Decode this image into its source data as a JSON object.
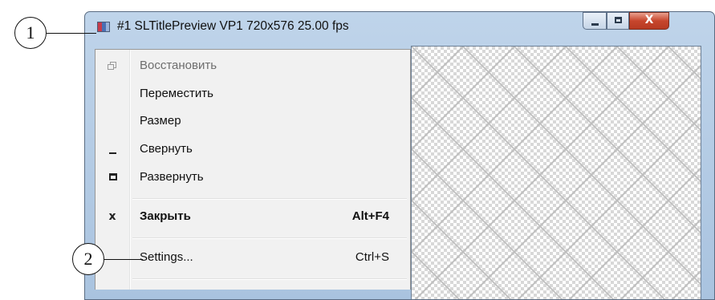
{
  "window": {
    "title": "#1 SLTitlePreview VP1 720x576 25.00 fps",
    "buttons": {
      "minimize": "minimize-icon",
      "maximize": "maximize-icon",
      "close_label": "X"
    }
  },
  "system_menu": {
    "items": [
      {
        "label": "Восстановить",
        "shortcut": "",
        "icon": "restore-icon",
        "disabled": true
      },
      {
        "label": "Переместить",
        "shortcut": "",
        "icon": "",
        "disabled": false
      },
      {
        "label": "Размер",
        "shortcut": "",
        "icon": "",
        "disabled": false
      },
      {
        "label": "Свернуть",
        "shortcut": "",
        "icon": "minimize-icon",
        "disabled": false
      },
      {
        "label": "Развернуть",
        "shortcut": "",
        "icon": "maximize-icon",
        "disabled": false
      },
      {
        "label": "Закрыть",
        "shortcut": "Alt+F4",
        "icon": "close-icon",
        "icon_glyph": "x",
        "bold": true
      },
      {
        "label": "Settings...",
        "shortcut": "Ctrl+S",
        "icon": "",
        "disabled": false
      }
    ]
  },
  "callouts": [
    {
      "number": "1"
    },
    {
      "number": "2"
    }
  ],
  "colors": {
    "titlebar": "#bfd4ea",
    "close_button": "#c7462d",
    "menu_background": "#f1f1f1"
  }
}
